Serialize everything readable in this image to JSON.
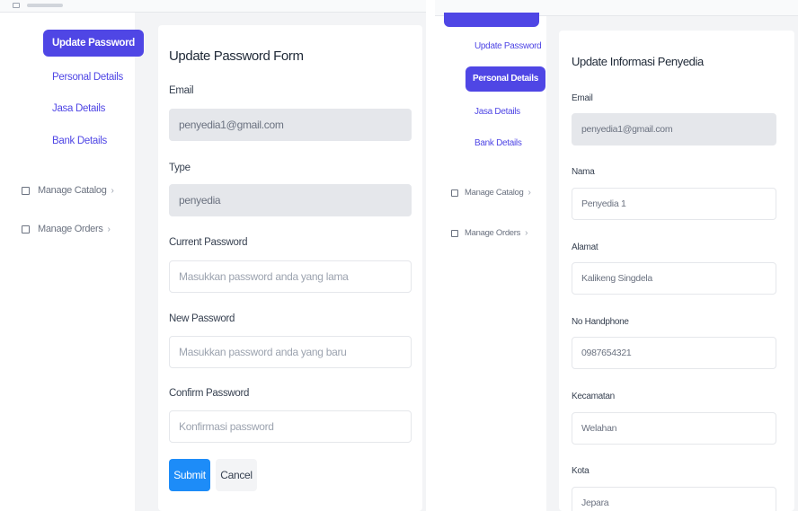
{
  "left": {
    "sidebar": {
      "items": [
        {
          "label": "Update Password",
          "active": true
        },
        {
          "label": "Personal Details",
          "active": false
        },
        {
          "label": "Jasa Details",
          "active": false
        },
        {
          "label": "Bank Details",
          "active": false
        }
      ],
      "menu": [
        {
          "label": "Manage Catalog",
          "icon": "catalog-icon"
        },
        {
          "label": "Manage Orders",
          "icon": "orders-icon"
        }
      ]
    },
    "form": {
      "title": "Update Password Form",
      "email_label": "Email",
      "email_value": "penyedia1@gmail.com",
      "type_label": "Type",
      "type_value": "penyedia",
      "current_label": "Current Password",
      "current_placeholder": "Masukkan password anda yang lama",
      "new_label": "New Password",
      "new_placeholder": "Masukkan password anda yang baru",
      "confirm_label": "Confirm Password",
      "confirm_placeholder": "Konfirmasi password",
      "submit_label": "Submit",
      "cancel_label": "Cancel"
    }
  },
  "right": {
    "sidebar": {
      "items": [
        {
          "label": "Update Password",
          "active": false
        },
        {
          "label": "Personal Details",
          "active": true
        },
        {
          "label": "Jasa Details",
          "active": false
        },
        {
          "label": "Bank Details",
          "active": false
        }
      ],
      "menu": [
        {
          "label": "Manage Catalog",
          "icon": "catalog-icon"
        },
        {
          "label": "Manage Orders",
          "icon": "orders-icon"
        }
      ]
    },
    "form": {
      "title": "Update Informasi Penyedia",
      "email_label": "Email",
      "email_value": "penyedia1@gmail.com",
      "nama_label": "Nama",
      "nama_value": "Penyedia 1",
      "alamat_label": "Alamat",
      "alamat_value": "Kalikeng Singdela",
      "hp_label": "No Handphone",
      "hp_value": "0987654321",
      "kecamatan_label": "Kecamatan",
      "kecamatan_value": "Welahan",
      "kota_label": "Kota",
      "kota_value": "Jepara"
    }
  },
  "colors": {
    "accent": "#4f46e5",
    "submit": "#1d8cf8",
    "readonly": "#e5e7eb",
    "background": "#f3f4f6"
  }
}
